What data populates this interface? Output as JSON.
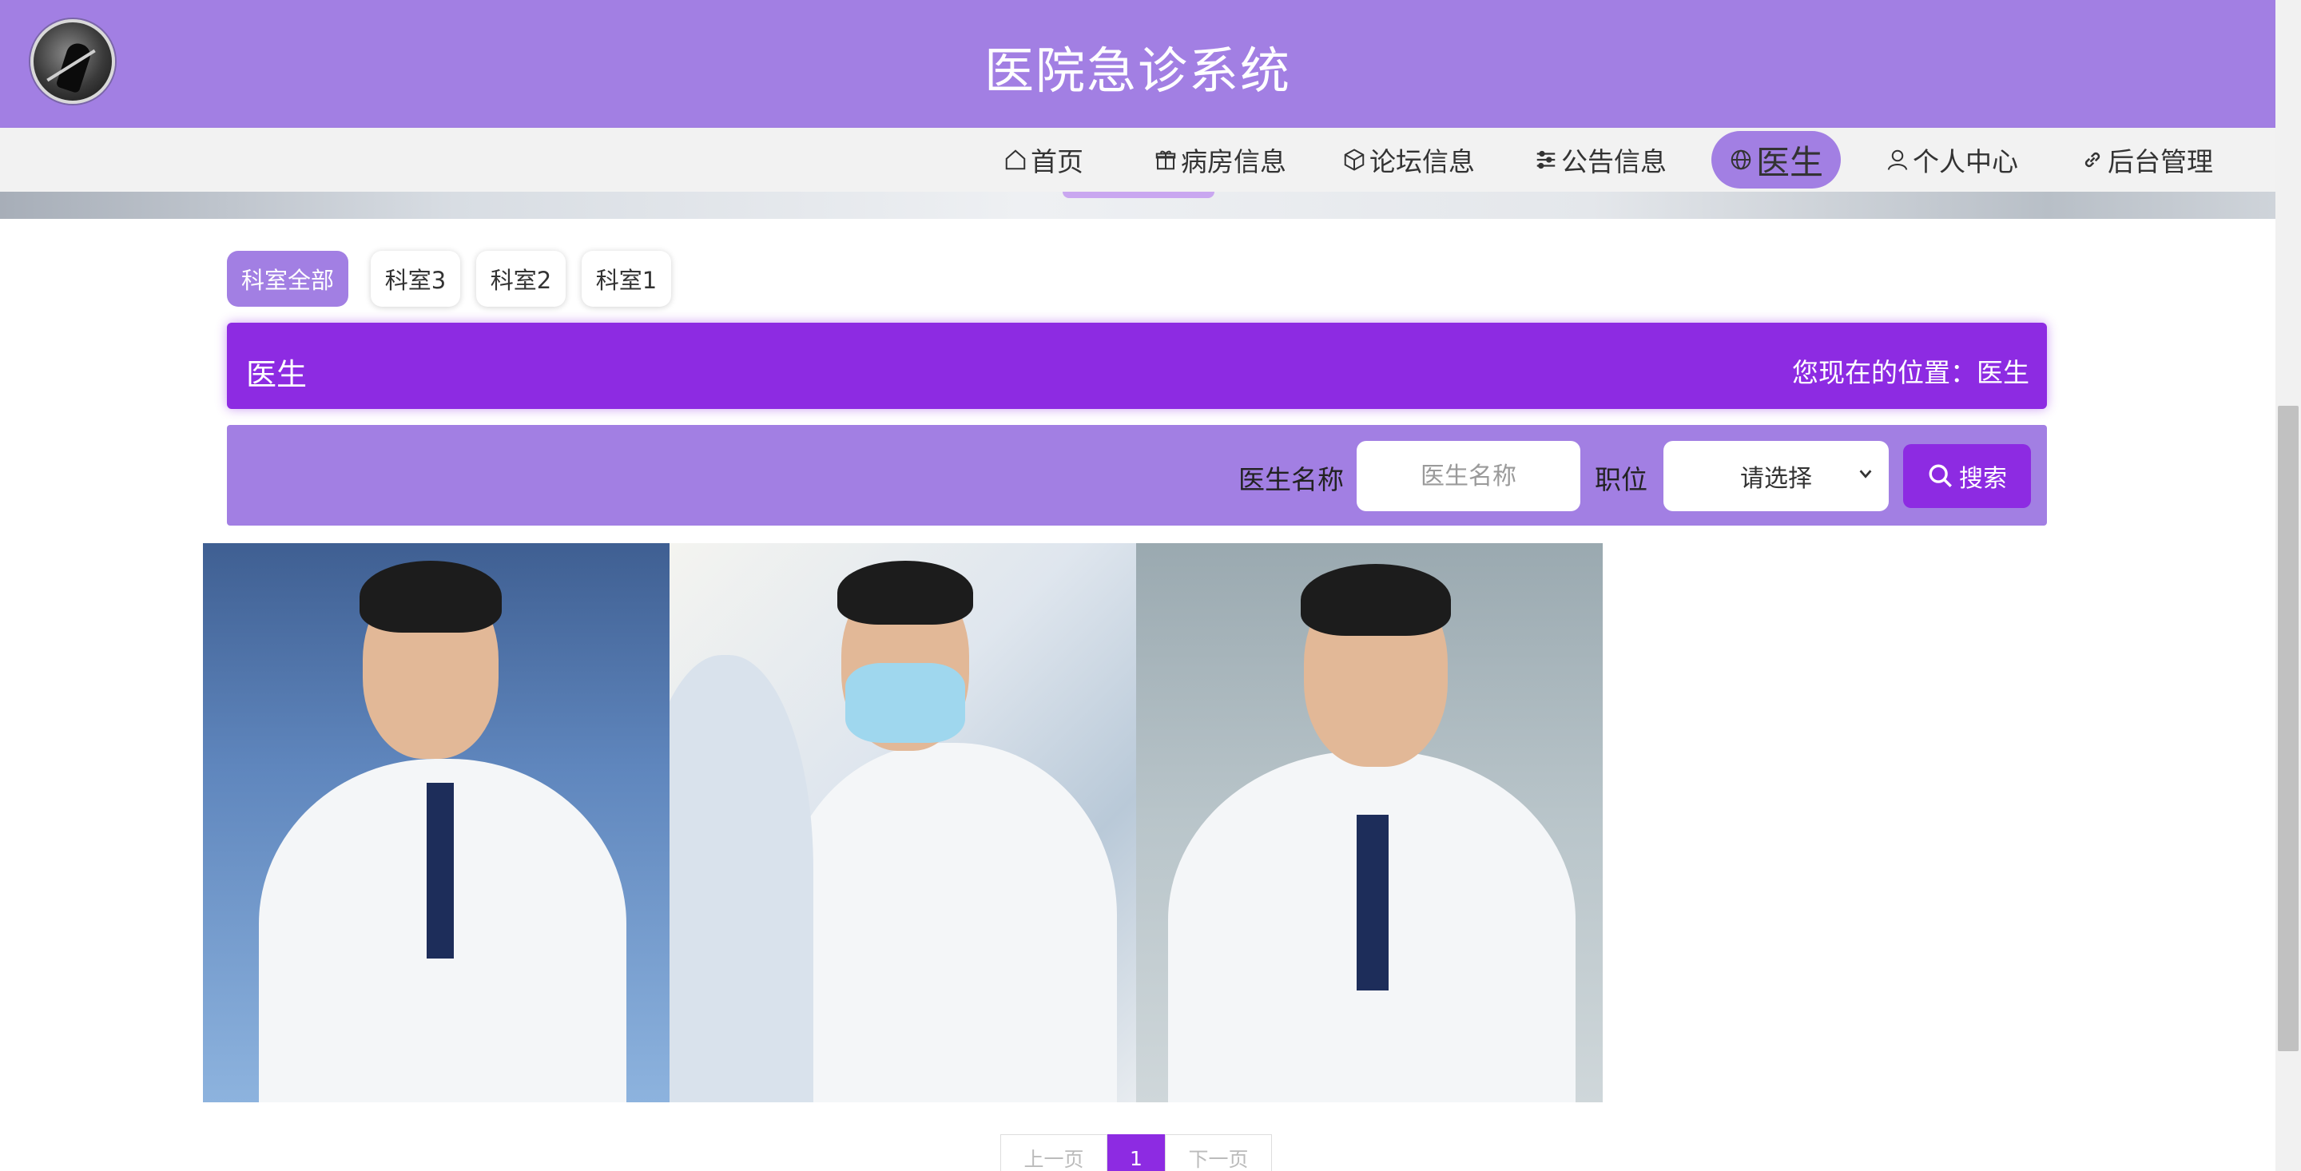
{
  "header": {
    "title": "医院急诊系统",
    "logo_icon": "avatar-logo-icon"
  },
  "nav": {
    "items": [
      {
        "label": "首页",
        "icon": "home-icon"
      },
      {
        "label": "病房信息",
        "icon": "gift-icon"
      },
      {
        "label": "论坛信息",
        "icon": "cube-icon"
      },
      {
        "label": "公告信息",
        "icon": "sliders-icon"
      },
      {
        "label": "医生",
        "icon": "globe-icon",
        "active": true
      },
      {
        "label": "个人中心",
        "icon": "user-icon"
      },
      {
        "label": "后台管理",
        "icon": "link-icon"
      }
    ]
  },
  "tabs": [
    {
      "label": "科室全部",
      "active": true
    },
    {
      "label": "科室3"
    },
    {
      "label": "科室2"
    },
    {
      "label": "科室1"
    }
  ],
  "title_bar": {
    "title": "医生",
    "location": "您现在的位置：医生"
  },
  "search": {
    "name_label": "医生名称",
    "name_placeholder": "医生名称",
    "position_label": "职位",
    "position_selected": "请选择",
    "button_label": "搜索"
  },
  "pagination": {
    "prev": "上一页",
    "current": "1",
    "next": "下一页"
  },
  "colors": {
    "header_bg": "#a27fe3",
    "accent": "#8d2be2",
    "nav_bg": "#f2f2f2"
  }
}
